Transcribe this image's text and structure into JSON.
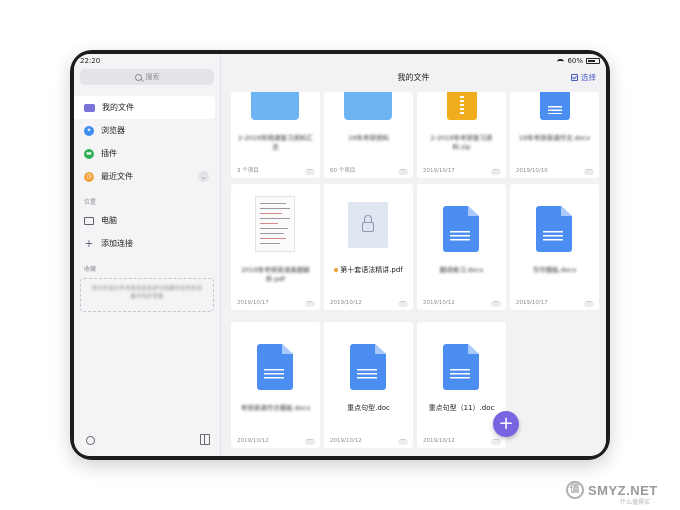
{
  "status": {
    "time": "22:20",
    "battery": "60%"
  },
  "sidebar": {
    "search_placeholder": "搜索",
    "items": [
      {
        "label": "我的文件",
        "icon": "folder-icon"
      },
      {
        "label": "浏览器",
        "icon": "compass-icon"
      },
      {
        "label": "插件",
        "icon": "plugin-icon"
      },
      {
        "label": "最近文件",
        "icon": "clock-icon"
      }
    ],
    "location_label": "位置",
    "locations": [
      {
        "label": "电脑",
        "icon": "computer-icon"
      },
      {
        "label": "添加连接",
        "icon": "plus-icon"
      }
    ],
    "favorites_label": "收藏",
    "favorites_hint": "将文件或文件夹拖至此处即可收藏并在所有设备中同步查看"
  },
  "main": {
    "title": "我的文件",
    "select_label": "选择",
    "files": [
      {
        "type": "folder",
        "name": "2-2019年网课复习资料汇总",
        "meta": "3 个项目",
        "blurred": true
      },
      {
        "type": "folder",
        "name": "19年考研资料",
        "meta": "60 个项目",
        "blurred": true
      },
      {
        "type": "zip",
        "name": "2-2019年考研复习资料.zip",
        "meta": "2019/10/17",
        "blurred": true
      },
      {
        "type": "docpart",
        "name": "19年考研英语作文.docx",
        "meta": "2019/10/10",
        "blurred": true
      },
      {
        "type": "pdf",
        "name": "2019年考研英语真题解析.pdf",
        "meta": "2019/10/17",
        "blurred": true
      },
      {
        "type": "locked",
        "name": "第十套语法精讲.pdf",
        "meta": "2019/10/12",
        "blurred": false,
        "dot": true
      },
      {
        "type": "doc",
        "name": "翻译练习.docx",
        "meta": "2019/10/12",
        "blurred": true
      },
      {
        "type": "doc",
        "name": "写作模板.docx",
        "meta": "2019/10/17",
        "blurred": true
      },
      {
        "type": "doc",
        "name": "考研英语作文模板.docx",
        "meta": "2019/10/12",
        "blurred": true
      },
      {
        "type": "doc",
        "name": "重点句型.doc",
        "meta": "2019/10/12",
        "blurred": false
      },
      {
        "type": "doc",
        "name": "重点句型（11）.doc",
        "meta": "2019/10/12",
        "blurred": false
      }
    ]
  },
  "watermark": {
    "text": "SMYZ.NET",
    "sub": "什么值得买"
  },
  "colors": {
    "accent": "#7a63e0",
    "folder": "#6cb4f2",
    "doc": "#4c8df2",
    "zip": "#f2ad1e"
  }
}
